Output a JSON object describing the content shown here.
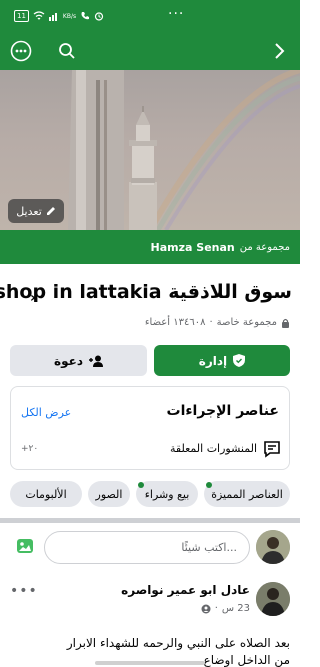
{
  "status_bar": {
    "left_text": "11",
    "net_speed": "KB/s",
    "dots": "···"
  },
  "topbar": {
    "more_icon": "more-circle-icon",
    "search_icon": "search-icon",
    "back_icon": "chevron-right-icon"
  },
  "cover": {
    "edit_label": "تعديل"
  },
  "group_banner": {
    "owner": "Hamza Senan",
    "from_label": "مجموعة من"
  },
  "group": {
    "title": "سوق اللاذقية shop in lattakia",
    "privacy": "مجموعة خاصة",
    "members": "١٣٤٦٠٨ أعضاء",
    "separator": "·"
  },
  "buttons": {
    "manage": "إدارة",
    "invite": "دعوة"
  },
  "actions_card": {
    "title": "عناصر الإجراءات",
    "see_all": "عرض الكل",
    "pending_label": "المنشورات المعلقة",
    "pending_count": "+٢٠"
  },
  "tabs": [
    {
      "label": "العناصر المميزة",
      "dot": true
    },
    {
      "label": "بيع وشراء",
      "dot": true
    },
    {
      "label": "الصور",
      "dot": false
    },
    {
      "label": "الألبومات",
      "dot": false
    }
  ],
  "composer": {
    "placeholder": "اكتب شيئًا..."
  },
  "post": {
    "author": "عادل ابو عمير نواصره",
    "time": "23 س",
    "text": "بعد الصلاه على النبي والرحمه للشهداء الابرار",
    "text2": "من الداخل اوضاع ..."
  },
  "colors": {
    "brand": "#1f8a3c",
    "link": "#1877f2"
  }
}
